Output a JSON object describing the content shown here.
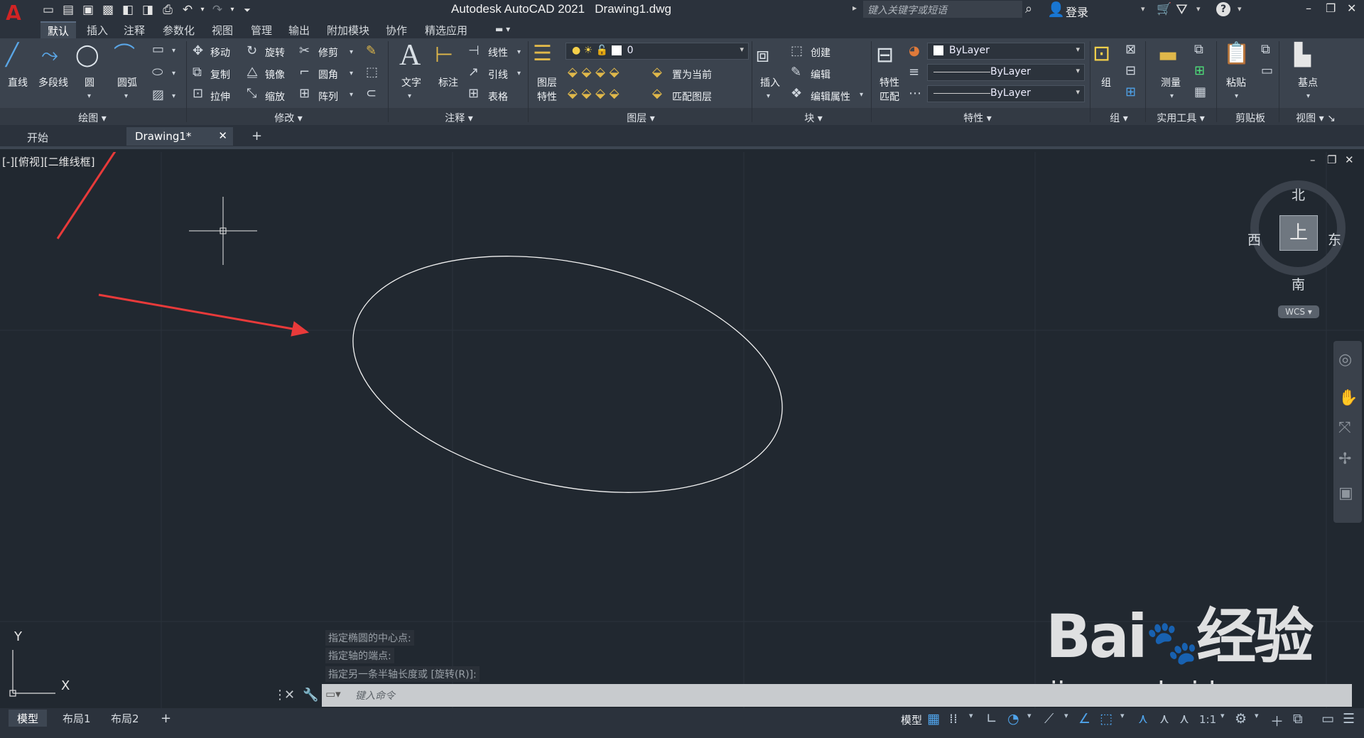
{
  "titlebar": {
    "app_name": "Autodesk AutoCAD 2021",
    "file_name": "Drawing1.dwg",
    "search_placeholder": "键入关键字或短语",
    "login_label": "登录"
  },
  "ribbon_tabs": [
    "默认",
    "插入",
    "注释",
    "参数化",
    "视图",
    "管理",
    "输出",
    "附加模块",
    "协作",
    "精选应用"
  ],
  "ribbon": {
    "draw": {
      "line": "直线",
      "polyline": "多段线",
      "circle": "圆",
      "arc": "圆弧",
      "panel_title": "绘图"
    },
    "modify": {
      "move": "移动",
      "rotate": "旋转",
      "trim": "修剪",
      "copy": "复制",
      "mirror": "镜像",
      "fillet": "圆角",
      "stretch": "拉伸",
      "scale": "缩放",
      "array": "阵列",
      "panel_title": "修改"
    },
    "annotation": {
      "text": "文字",
      "dimension": "标注",
      "linear": "线性",
      "leader": "引线",
      "table": "表格",
      "panel_title": "注释"
    },
    "layers": {
      "layer_props": "图层",
      "layer_props2": "特性",
      "current_layer": "0",
      "set_current": "置为当前",
      "match_layer": "匹配图层",
      "panel_title": "图层"
    },
    "block": {
      "insert": "插入",
      "create": "创建",
      "edit": "编辑",
      "edit_attr": "编辑属性",
      "panel_title": "块"
    },
    "properties": {
      "match": "特性",
      "match2": "匹配",
      "color": "ByLayer",
      "linetype": "ByLayer",
      "lineweight": "ByLayer",
      "panel_title": "特性"
    },
    "groups": {
      "group": "组",
      "panel_title": "组"
    },
    "utilities": {
      "measure": "测量",
      "panel_title": "实用工具"
    },
    "clipboard": {
      "paste": "粘贴",
      "panel_title": "剪贴板"
    },
    "view": {
      "base": "基点",
      "panel_title": "视图"
    }
  },
  "doc_tabs": {
    "start": "开始",
    "drawing": "Drawing1*"
  },
  "viewport": {
    "label": "[-][俯视][二维线框]",
    "north": "北",
    "south": "南",
    "east": "东",
    "west": "西",
    "face": "上",
    "wcs": "WCS"
  },
  "ucs": {
    "x": "X",
    "y": "Y"
  },
  "command": {
    "history": [
      "指定椭圆的中心点:",
      "指定轴的端点:",
      "指定另一条半轴长度或 [旋转(R)]:"
    ],
    "placeholder": "键入命令"
  },
  "layout_tabs": [
    "模型",
    "布局1",
    "布局2"
  ],
  "status": {
    "model": "模型",
    "scale": "1:1"
  },
  "watermark": {
    "brand": "Bai",
    "suffix": "经验",
    "url": "jingyan.baidu.com"
  },
  "colors": {
    "canvas": "#212830",
    "ribbon": "#3b434e",
    "annotation_arrow": "#e83a3a",
    "ellipse": "#f2f2f2"
  }
}
